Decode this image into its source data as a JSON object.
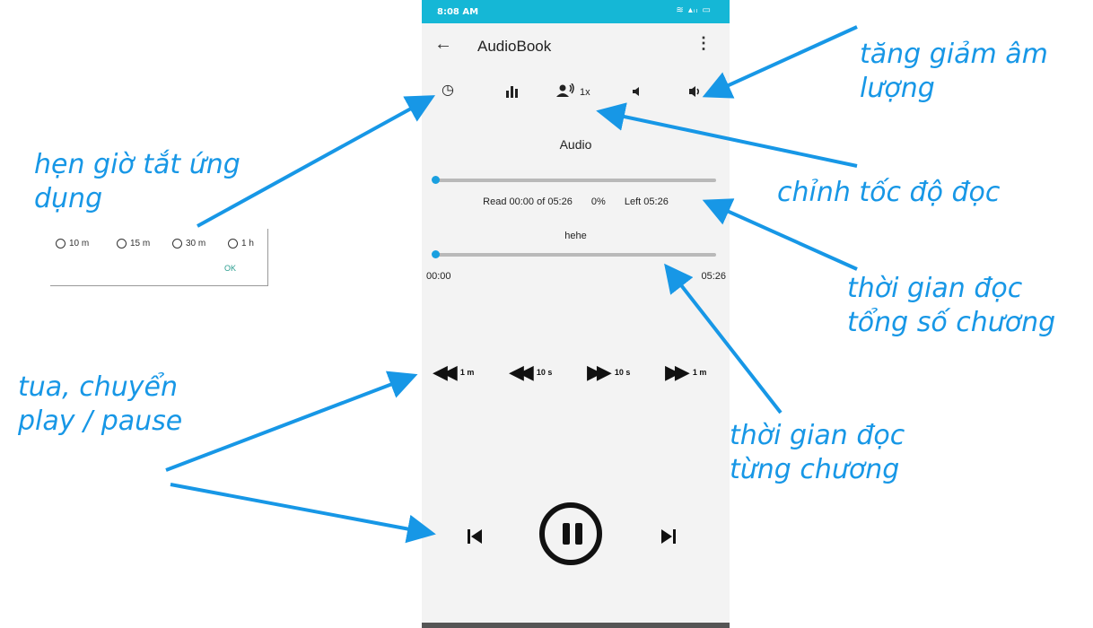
{
  "status_bar": {
    "time": "8:08 AM",
    "icons": "≋ ▴ᵢₗ ▭"
  },
  "app_bar": {
    "back_icon": "←",
    "title": "AudioBook",
    "more_icon": "⋮"
  },
  "toolbar": {
    "timer_icon": "◷",
    "equalizer_icon": "▮▮",
    "speed_icon": "🗣",
    "speed_label": "1x",
    "volume_down_icon": "🔈",
    "volume_up_icon": "🔊"
  },
  "audio": {
    "title": "Audio",
    "total_progress": {
      "read": "Read 00:00 of 05:26",
      "percent": "0%",
      "left": "Left 05:26",
      "fraction": 0
    },
    "chapter_title": "hehe",
    "chapter_progress": {
      "start": "00:00",
      "end": "05:26",
      "fraction": 0
    }
  },
  "seek_controls": [
    {
      "icon": "◀◀",
      "label": "1 m"
    },
    {
      "icon": "◀◀",
      "label": "10 s"
    },
    {
      "icon": "▶▶",
      "label": "10 s"
    },
    {
      "icon": "▶▶",
      "label": "1 m"
    }
  ],
  "playback": {
    "prev_icon": "⏮",
    "next_icon": "⏭"
  },
  "timer_dialog": {
    "options": [
      "10 m",
      "15 m",
      "30 m",
      "1 h"
    ],
    "ok_label": "OK"
  },
  "annotations": {
    "volume": "tăng giảm âm lượng",
    "timer": "hẹn giờ tắt ứng dụng",
    "speed": "chỉnh tốc độ đọc",
    "total_time": "thời gian đọc tổng số chương",
    "seek": "tua, chuyển play / pause",
    "chapter_time": "thời gian đọc từng chương"
  },
  "colors": {
    "status_bar": "#15b7d6",
    "accent": "#1aa0e0",
    "annotation": "#1797e6",
    "ok": "#2a9d8f"
  }
}
